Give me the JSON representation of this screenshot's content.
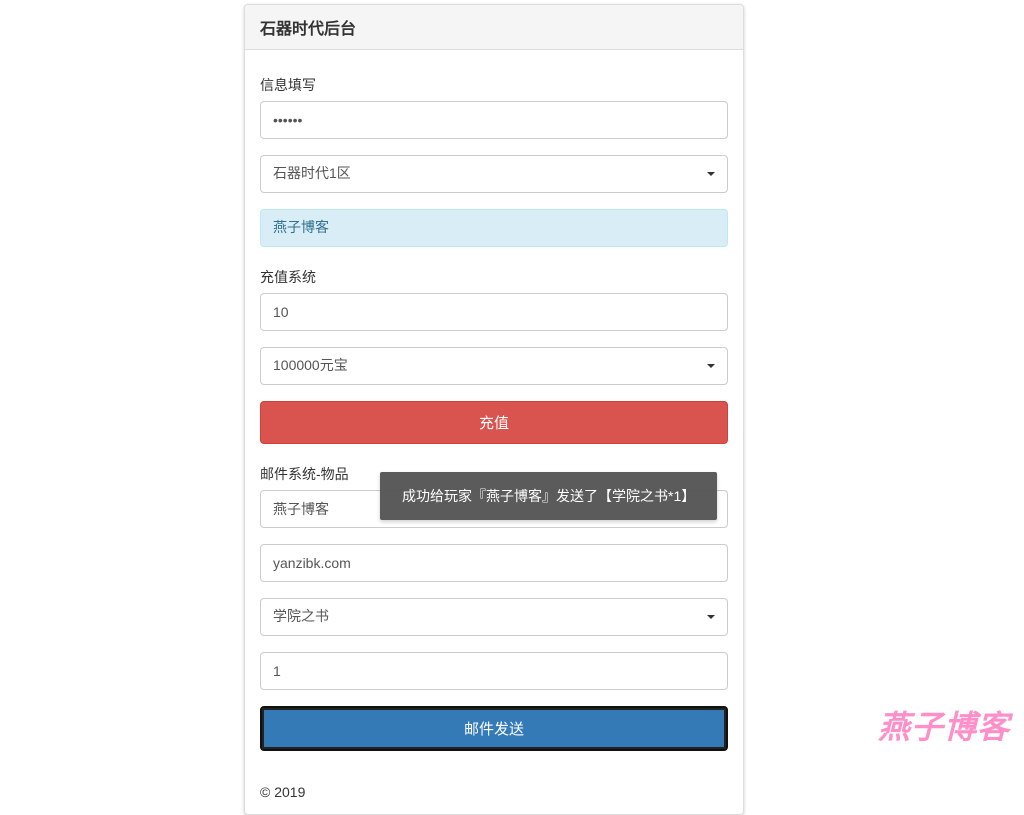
{
  "header": {
    "title": "石器时代后台"
  },
  "info": {
    "section_label": "信息填写",
    "password_value": "••••••",
    "server_dropdown": "石器时代1区",
    "highlight_value": "燕子博客"
  },
  "recharge": {
    "section_label": "充值系统",
    "amount_value": "10",
    "yuanbao_dropdown": "100000元宝",
    "button_label": "充值"
  },
  "mail": {
    "section_label": "邮件系统-物品",
    "target_value": "燕子博客",
    "domain_value": "yanzibk.com",
    "item_dropdown": "学院之书",
    "qty_value": "1",
    "button_label": "邮件发送"
  },
  "toast": {
    "text": "成功给玩家『燕子博客』发送了【学院之书*1】"
  },
  "footer": {
    "copyright": "© 2019"
  },
  "watermark": {
    "text": "燕子博客"
  }
}
